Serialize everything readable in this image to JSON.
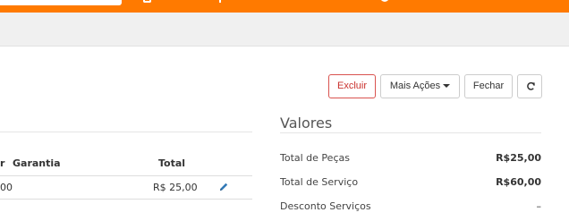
{
  "toolbar": {
    "excluir_label": "Excluir",
    "mais_acoes_label": "Mais Ações",
    "fechar_label": "Fechar",
    "refresh_icon": "refresh-icon"
  },
  "items_table": {
    "headers": [
      "r",
      "Garantia",
      "Total"
    ],
    "rows": [
      {
        "col1": "00",
        "total": "R$ 25,00",
        "action_icon": "pencil-icon"
      }
    ]
  },
  "valores": {
    "title": "Valores",
    "rows": [
      {
        "label": "Total de Peças",
        "value": "R$25,00"
      },
      {
        "label": "Total de Serviço",
        "value": "R$60,00"
      },
      {
        "label": "Desconto Serviços",
        "value": "–"
      }
    ]
  },
  "colors": {
    "topbar": "#ff7a00",
    "danger": "#d9534f",
    "edit_icon": "#337ab7"
  }
}
